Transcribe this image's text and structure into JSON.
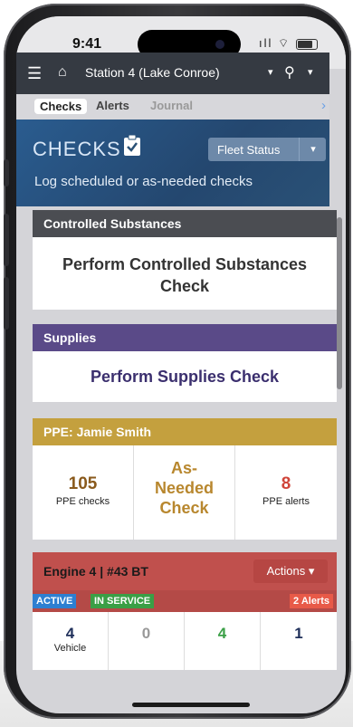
{
  "status": {
    "time": "9:41",
    "signal": "▐▐▐",
    "wifi": "◠"
  },
  "appbar": {
    "menu_icon": "hamburger-icon",
    "home_icon": "home-icon",
    "station": "Station 4 (Lake Conroe)",
    "caret": "▾",
    "user_icon": "user-icon"
  },
  "tabs": {
    "checks": "Checks",
    "alerts": "Alerts",
    "journal": "Journal",
    "chevron": "›"
  },
  "header": {
    "title": "CHECKS",
    "icon": "📋",
    "subtitle": "Log scheduled or as-needed checks",
    "fleet_label": "Fleet Status",
    "fleet_caret": "▾"
  },
  "controlled": {
    "heading": "Controlled Substances",
    "action_line1": "Perform Controlled Substances",
    "action_line2": "Check"
  },
  "supplies": {
    "heading": "Supplies",
    "action": "Perform Supplies Check"
  },
  "ppe": {
    "heading": "PPE: Jamie Smith",
    "checks_value": "105",
    "checks_label": "PPE checks",
    "as_needed_1": "As-",
    "as_needed_2": "Needed",
    "as_needed_3": "Check",
    "alerts_value": "8",
    "alerts_label": "PPE alerts",
    "colors": {
      "checks": "#8a5a1c",
      "as_needed": "#b8872e",
      "alerts": "#d0453a"
    }
  },
  "engine": {
    "title": "Engine 4 | #43 BT",
    "actions": "Actions ▾",
    "badge_active": "ACTIVE",
    "badge_service": "IN SERVICE",
    "badge_alerts": "2 Alerts",
    "stats": [
      {
        "value": "4",
        "label": "Vehicle",
        "color": "#1f2f5a"
      },
      {
        "value": "0",
        "label": "",
        "color": "#999999"
      },
      {
        "value": "4",
        "label": "",
        "color": "#3a9f46"
      },
      {
        "value": "1",
        "label": "",
        "color": "#1f2f5a"
      }
    ]
  }
}
